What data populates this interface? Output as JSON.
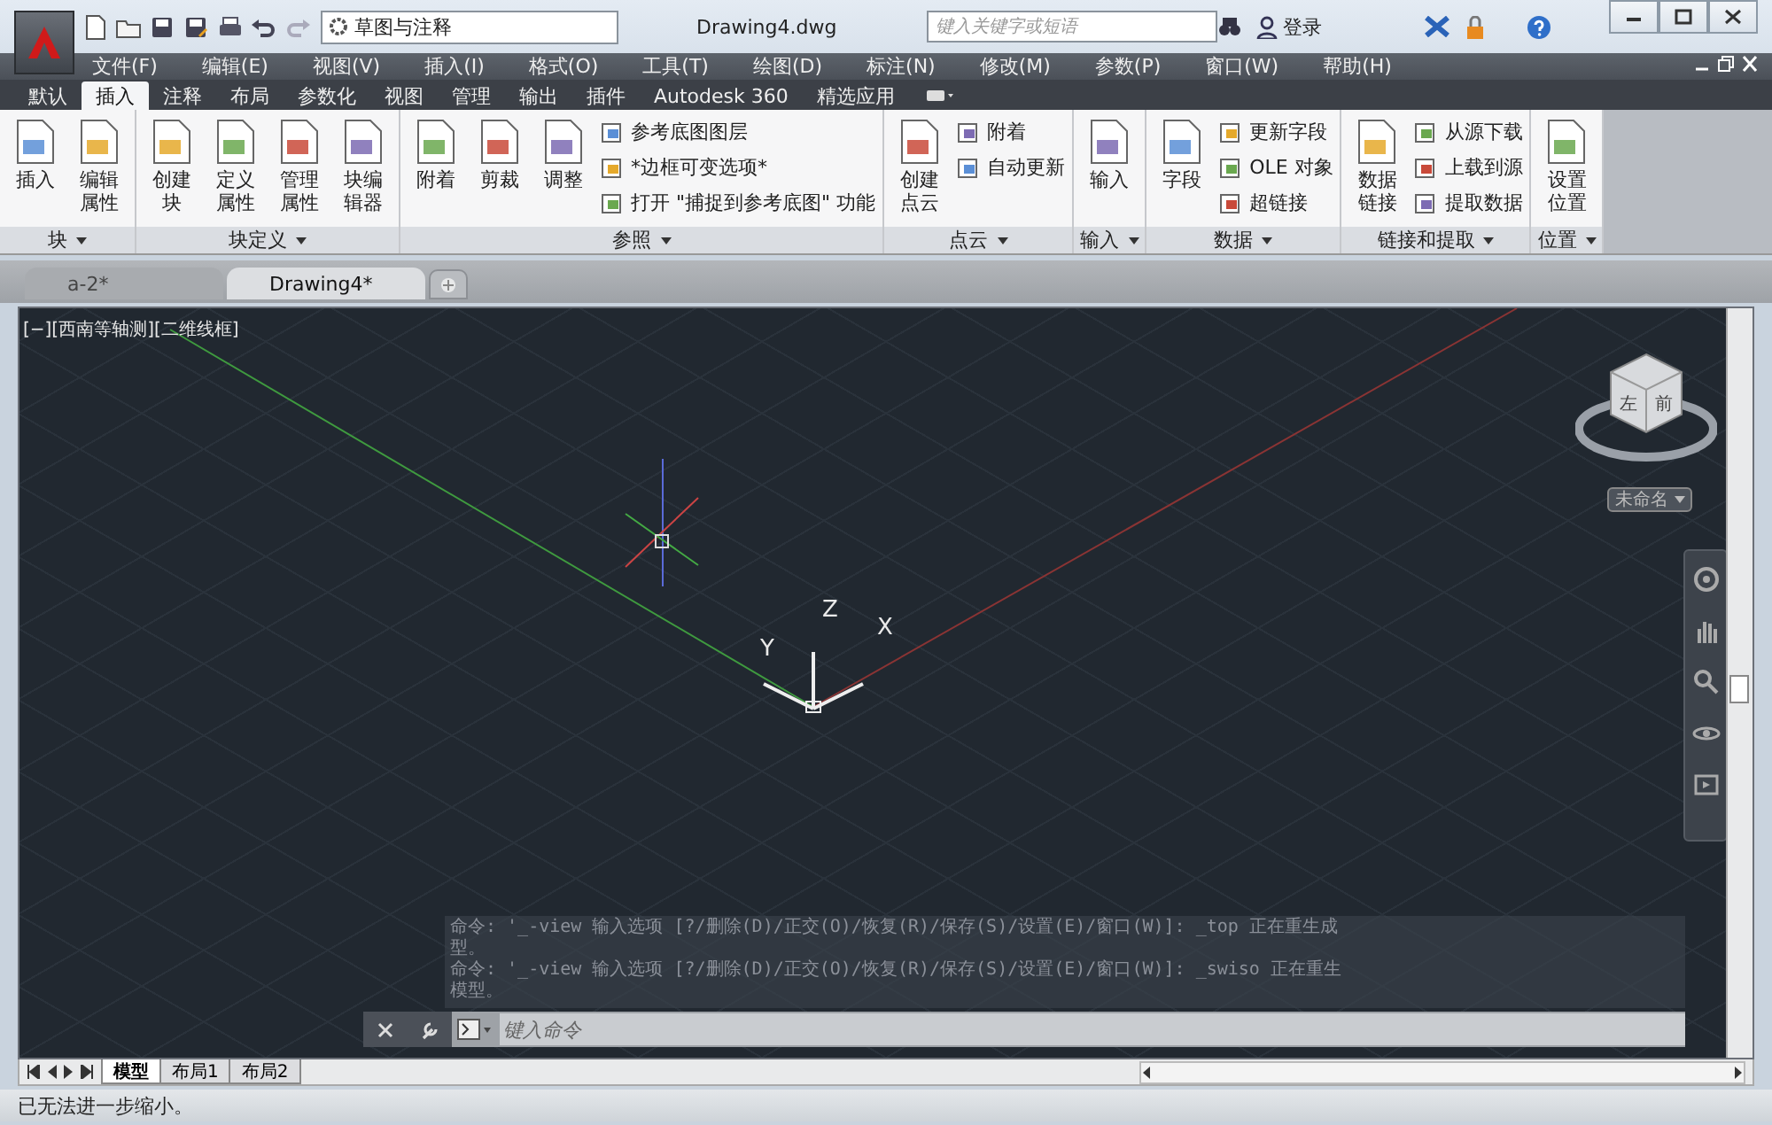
{
  "window": {
    "title": "Drawing4.dwg",
    "workspace": "草图与注释",
    "search_placeholder": "键入关键字或短语",
    "login": "登录"
  },
  "menu": [
    "文件(F)",
    "编辑(E)",
    "视图(V)",
    "插入(I)",
    "格式(O)",
    "工具(T)",
    "绘图(D)",
    "标注(N)",
    "修改(M)",
    "参数(P)",
    "窗口(W)",
    "帮助(H)"
  ],
  "ribbon_tabs": [
    {
      "label": "默认",
      "selected": false
    },
    {
      "label": "插入",
      "selected": true
    },
    {
      "label": "注释",
      "selected": false
    },
    {
      "label": "布局",
      "selected": false
    },
    {
      "label": "参数化",
      "selected": false
    },
    {
      "label": "视图",
      "selected": false
    },
    {
      "label": "管理",
      "selected": false
    },
    {
      "label": "输出",
      "selected": false
    },
    {
      "label": "插件",
      "selected": false
    },
    {
      "label": "Autodesk 360",
      "selected": false
    },
    {
      "label": "精选应用",
      "selected": false
    }
  ],
  "ribbon_panels": [
    {
      "title": "块",
      "tools": [
        {
          "label": "插入",
          "kind": "large"
        },
        {
          "label": "编辑属性",
          "kind": "large"
        }
      ]
    },
    {
      "title": "块定义",
      "tools": [
        {
          "label": "创建块",
          "kind": "large"
        },
        {
          "label": "定义属性",
          "kind": "large"
        },
        {
          "label": "管理属性",
          "kind": "large"
        },
        {
          "label": "块编辑器",
          "kind": "large"
        }
      ]
    },
    {
      "title": "参照",
      "tools": [
        {
          "label": "附着",
          "kind": "large"
        },
        {
          "label": "剪裁",
          "kind": "large"
        },
        {
          "label": "调整",
          "kind": "large"
        },
        {
          "label": "参考底图图层",
          "kind": "small"
        },
        {
          "label": "*边框可变选项*",
          "kind": "small"
        },
        {
          "label": "打开 \"捕捉到参考底图\" 功能",
          "kind": "small"
        }
      ]
    },
    {
      "title": "点云",
      "tools": [
        {
          "label": "创建点云",
          "kind": "large"
        },
        {
          "label": "附着",
          "kind": "small"
        },
        {
          "label": "自动更新",
          "kind": "small"
        }
      ]
    },
    {
      "title": "输入",
      "tools": [
        {
          "label": "输入",
          "kind": "large"
        }
      ]
    },
    {
      "title": "数据",
      "tools": [
        {
          "label": "字段",
          "kind": "large"
        },
        {
          "label": "更新字段",
          "kind": "small"
        },
        {
          "label": "OLE 对象",
          "kind": "small"
        },
        {
          "label": "超链接",
          "kind": "small"
        }
      ]
    },
    {
      "title": "链接和提取",
      "tools": [
        {
          "label": "数据链接",
          "kind": "large"
        },
        {
          "label": "从源下载",
          "kind": "small"
        },
        {
          "label": "上载到源",
          "kind": "small"
        },
        {
          "label": "提取数据",
          "kind": "small"
        }
      ]
    },
    {
      "title": "位置",
      "tools": [
        {
          "label": "设置位置",
          "kind": "large"
        }
      ]
    }
  ],
  "doc_tabs": [
    {
      "label": "a-2*",
      "selected": false
    },
    {
      "label": "Drawing4*",
      "selected": true
    }
  ],
  "viewport": {
    "label": "[−][西南等轴测][二维线框]",
    "viewcube_faces": [
      "左",
      "前"
    ],
    "viewcube_label": "未命名",
    "ucs_axes": [
      "X",
      "Y",
      "Z"
    ]
  },
  "command": {
    "history": [
      "命令: '_-view 输入选项 [?/删除(D)/正交(O)/恢复(R)/保存(S)/设置(E)/窗口(W)]: _top 正在重生成",
      "型。",
      "命令: '_-view 输入选项 [?/删除(D)/正交(O)/恢复(R)/保存(S)/设置(E)/窗口(W)]: _swiso 正在重生",
      "模型。"
    ],
    "placeholder": "键入命令"
  },
  "layout_tabs": [
    {
      "label": "模型",
      "selected": true
    },
    {
      "label": "布局1",
      "selected": false
    },
    {
      "label": "布局2",
      "selected": false
    }
  ],
  "status_bar": "已无法进一步缩小。"
}
